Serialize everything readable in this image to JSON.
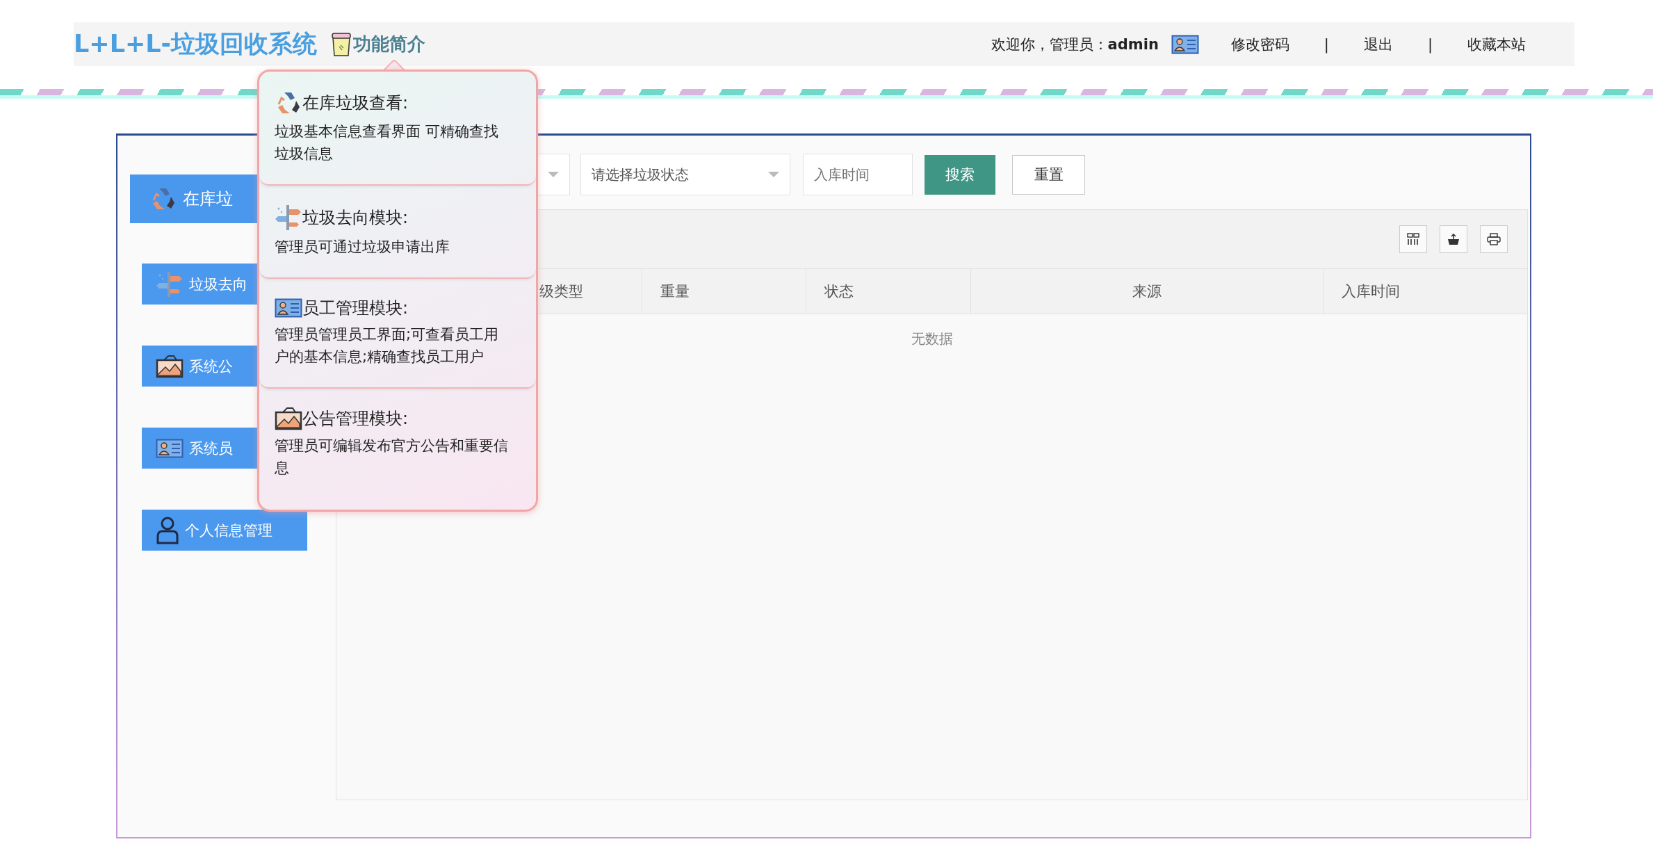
{
  "header": {
    "title": "L+L+L-垃圾回收系统",
    "intro_link": "功能简介",
    "welcome": "欢迎你，管理员：",
    "user": "admin",
    "links": [
      "修改密码",
      "退出",
      "收藏本站"
    ],
    "separators": [
      "|",
      "|"
    ]
  },
  "intro_popover": [
    {
      "title": "在库垃圾查看:",
      "description": "垃圾基本信息查看界面 可精确查找垃圾信息"
    },
    {
      "title": "垃圾去向模块:",
      "description": "管理员可通过垃圾申请出库"
    },
    {
      "title": "员工管理模块:",
      "description": "管理员管理员工界面;可查看员工用户的基本信息;精确查找员工用户"
    },
    {
      "title": "公告管理模块:",
      "description": "管理员可编辑发布官方公告和重要信息"
    }
  ],
  "sidebar": {
    "items": [
      {
        "label": "在库垃",
        "selected": true
      },
      {
        "label": "垃圾去向",
        "selected": false
      },
      {
        "label": "系统公",
        "selected": false
      },
      {
        "label": "系统员",
        "selected": false
      },
      {
        "label": "个人信息管理",
        "selected": false
      }
    ]
  },
  "filters": [
    {
      "kind": "select"
    },
    {
      "kind": "select",
      "placeholder": "请选择垃圾状态"
    },
    {
      "kind": "input",
      "placeholder": "入库时间"
    }
  ],
  "buttons": [
    {
      "kind": "primary",
      "label": "搜索"
    },
    {
      "kind": "default",
      "label": "重置"
    }
  ],
  "table": {
    "columns": [
      "级类型",
      "重量",
      "状态",
      "来源",
      "入库时间"
    ],
    "empty_text": "无数据"
  }
}
